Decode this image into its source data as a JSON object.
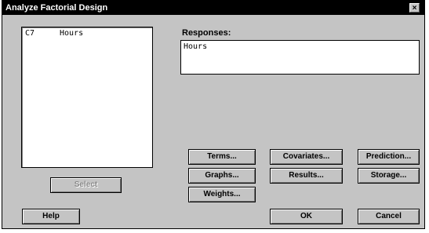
{
  "window": {
    "title": "Analyze Factorial Design",
    "close_label": "×"
  },
  "variables": {
    "items": [
      {
        "col": "C7",
        "name": "Hours"
      }
    ]
  },
  "responses": {
    "label": "Responses:",
    "value": "Hours"
  },
  "buttons": {
    "select": "Select",
    "terms": "Terms...",
    "covariates": "Covariates...",
    "prediction": "Prediction...",
    "graphs": "Graphs...",
    "results": "Results...",
    "storage": "Storage...",
    "weights": "Weights...",
    "help": "Help",
    "ok": "OK",
    "cancel": "Cancel"
  }
}
